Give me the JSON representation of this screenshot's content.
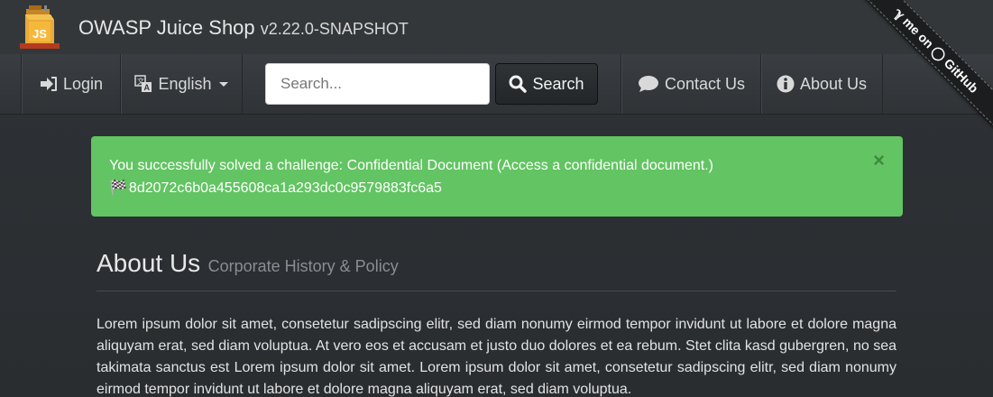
{
  "brand": {
    "title": "OWASP Juice Shop",
    "version": "v2.22.0-SNAPSHOT",
    "logo_icon": "juice-box-logo"
  },
  "nav": {
    "login_label": "Login",
    "login_icon": "sign-in-icon",
    "language_label": "English",
    "language_icon": "translate-icon",
    "search_placeholder": "Search...",
    "search_button_label": "Search",
    "search_icon": "magnifier-icon",
    "contact_label": "Contact Us",
    "contact_icon": "speech-bubble-icon",
    "about_label": "About Us",
    "about_icon": "info-circle-icon"
  },
  "ribbon": {
    "label": "Fork me on GitHub",
    "visible_text": "ℽ me on ◯ GitHub"
  },
  "alert": {
    "message": "You successfully solved a challenge: Confidential Document (Access a confidential document.)",
    "flag_glyph": "🏁",
    "flag_code": "8d2072c6b0a455608ca1a293dc0c9579883fc6a5",
    "close_label": "×",
    "color": "#62c462"
  },
  "page": {
    "title": "About Us",
    "subtitle": "Corporate History & Policy",
    "body": "Lorem ipsum dolor sit amet, consetetur sadipscing elitr, sed diam nonumy eirmod tempor invidunt ut labore et dolore magna aliquyam erat, sed diam voluptua. At vero eos et accusam et justo duo dolores et ea rebum. Stet clita kasd gubergren, no sea takimata sanctus est Lorem ipsum dolor sit amet. Lorem ipsum dolor sit amet, consetetur sadipscing elitr, sed diam nonumy eirmod tempor invidunt ut labore et dolore magna aliquyam erat, sed diam voluptua."
  },
  "colors": {
    "background": "#2b2f32",
    "navbar": "#33373a",
    "success": "#62c462"
  }
}
